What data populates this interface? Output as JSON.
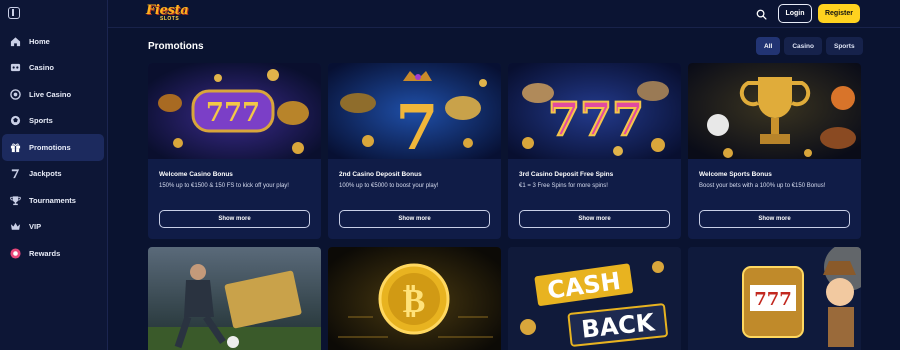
{
  "brand": {
    "logo_main": "Fiesta",
    "logo_sub": "SLOTS"
  },
  "header": {
    "login_label": "Login",
    "register_label": "Register"
  },
  "sidebar": {
    "items": [
      {
        "label": "Home",
        "icon": "home-icon"
      },
      {
        "label": "Casino",
        "icon": "casino-icon"
      },
      {
        "label": "Live Casino",
        "icon": "live-casino-icon"
      },
      {
        "label": "Sports",
        "icon": "sports-icon"
      },
      {
        "label": "Promotions",
        "icon": "gift-icon",
        "active": true
      },
      {
        "label": "Jackpots",
        "icon": "jackpot-icon"
      },
      {
        "label": "Tournaments",
        "icon": "trophy-icon"
      },
      {
        "label": "VIP",
        "icon": "crown-icon"
      },
      {
        "label": "Rewards",
        "icon": "rewards-icon"
      }
    ]
  },
  "page": {
    "title": "Promotions"
  },
  "filters": [
    {
      "label": "All",
      "active": true
    },
    {
      "label": "Casino",
      "active": false
    },
    {
      "label": "Sports",
      "active": false
    }
  ],
  "promotions": [
    {
      "title": "Welcome Casino Bonus",
      "description": "150% up to €1500 & 150 FS to kick off your play!",
      "button": "Show more",
      "image": "slot-777-purple-masks"
    },
    {
      "title": "2nd Casino Deposit Bonus",
      "description": "100% up to €5000 to boost your play!",
      "button": "Show more",
      "image": "golden-7-crown"
    },
    {
      "title": "3rd Casino Deposit Free Spins",
      "description": "€1 = 3 Free Spins for more spins!",
      "button": "Show more",
      "image": "777-masks-coins"
    },
    {
      "title": "Welcome Sports Bonus",
      "description": "Boost your bets with a 100% up to €150 Bonus!",
      "button": "Show more",
      "image": "golden-trophy-balls"
    },
    {
      "title": "",
      "description": "",
      "button": "",
      "image": "football-player-ticket"
    },
    {
      "title": "",
      "description": "",
      "button": "",
      "image": "bitcoin-coin"
    },
    {
      "title": "",
      "description": "",
      "button": "",
      "image": "cash-back"
    },
    {
      "title": "",
      "description": "",
      "button": "",
      "image": "slot-machine-detective"
    }
  ],
  "cashback_text": {
    "line1": "CASH",
    "line2": "BACK"
  },
  "colors": {
    "accent": "#ffd21f",
    "background": "#0a1330",
    "card": "#101c47",
    "sidebar_active": "#1c2a5e"
  }
}
